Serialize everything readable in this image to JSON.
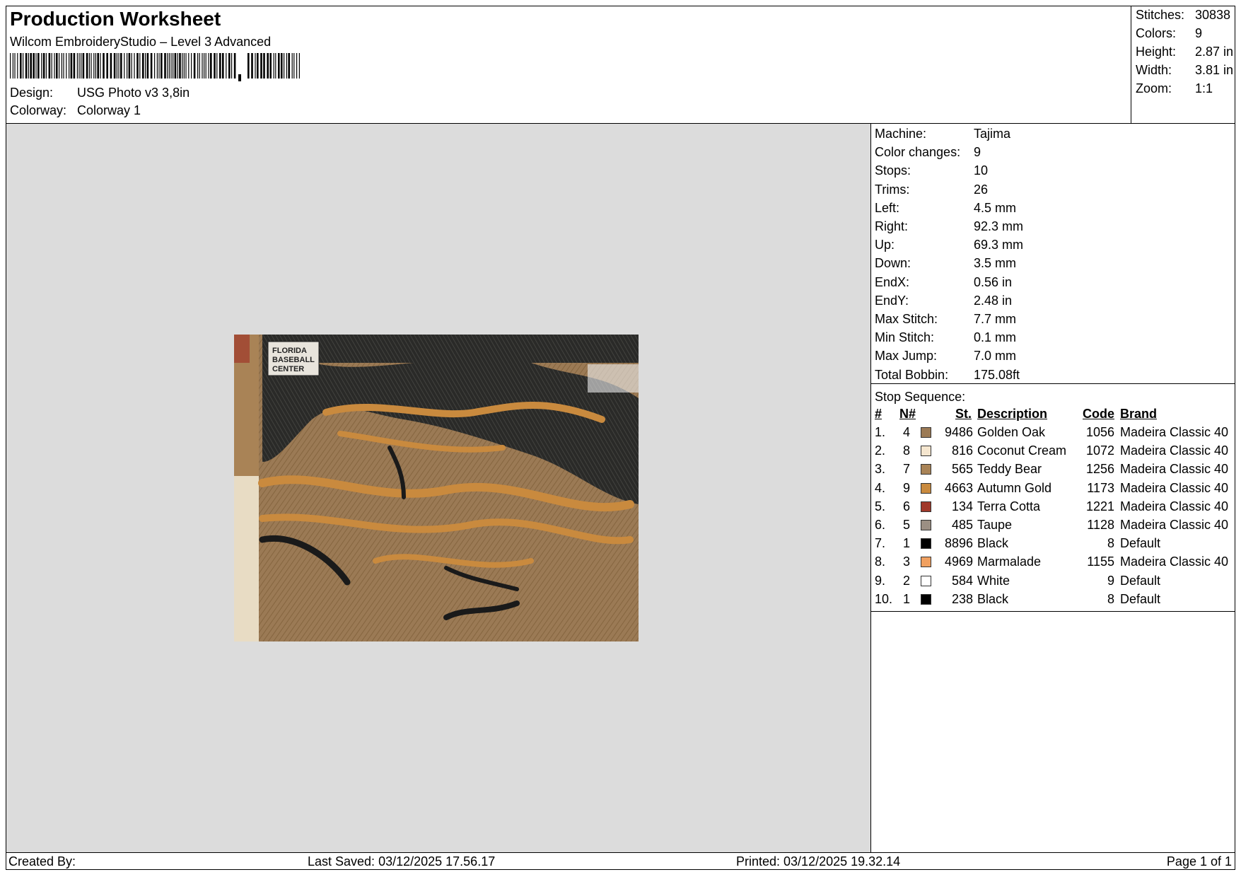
{
  "header": {
    "title": "Production Worksheet",
    "software": "Wilcom EmbroideryStudio – Level 3 Advanced",
    "design_label": "Design:",
    "design_value": "USG Photo v3 3,8in",
    "colorway_label": "Colorway:",
    "colorway_value": "Colorway 1"
  },
  "stats": [
    {
      "label": "Stitches:",
      "value": "30838"
    },
    {
      "label": "Colors:",
      "value": "9"
    },
    {
      "label": "Height:",
      "value": "2.87 in"
    },
    {
      "label": "Width:",
      "value": "3.81 in"
    },
    {
      "label": "Zoom:",
      "value": "1:1"
    }
  ],
  "preview": {
    "logo_lines": [
      "FLORIDA",
      "BASEBALL",
      "CENTER"
    ]
  },
  "machine": [
    {
      "label": "Machine:",
      "value": "Tajima"
    },
    {
      "label": "Color changes:",
      "value": "9"
    },
    {
      "label": "Stops:",
      "value": "10"
    },
    {
      "label": "Trims:",
      "value": "26"
    },
    {
      "label": "Left:",
      "value": "4.5 mm"
    },
    {
      "label": "Right:",
      "value": "92.3 mm"
    },
    {
      "label": "Up:",
      "value": "69.3 mm"
    },
    {
      "label": "Down:",
      "value": "3.5 mm"
    },
    {
      "label": "EndX:",
      "value": "0.56 in"
    },
    {
      "label": "EndY:",
      "value": "2.48 in"
    },
    {
      "label": "Max Stitch:",
      "value": "7.7 mm"
    },
    {
      "label": "Min Stitch:",
      "value": "0.1 mm"
    },
    {
      "label": "Max Jump:",
      "value": "7.0 mm"
    },
    {
      "label": "Total Bobbin:",
      "value": "175.08ft"
    }
  ],
  "stop_sequence": {
    "title": "Stop Sequence:",
    "headers": {
      "num": "#",
      "n": "N#",
      "st": "St.",
      "desc": "Description",
      "code": "Code",
      "brand": "Brand"
    },
    "rows": [
      {
        "num": "1.",
        "n": "4",
        "color": "#9b7a55",
        "st": "9486",
        "desc": "Golden Oak",
        "code": "1056",
        "brand": "Madeira Classic 40"
      },
      {
        "num": "2.",
        "n": "8",
        "color": "#f5e6cf",
        "st": "816",
        "desc": "Coconut Cream",
        "code": "1072",
        "brand": "Madeira Classic 40"
      },
      {
        "num": "3.",
        "n": "7",
        "color": "#a98356",
        "st": "565",
        "desc": "Teddy Bear",
        "code": "1256",
        "brand": "Madeira Classic 40"
      },
      {
        "num": "4.",
        "n": "9",
        "color": "#c98a3e",
        "st": "4663",
        "desc": "Autumn Gold",
        "code": "1173",
        "brand": "Madeira Classic 40"
      },
      {
        "num": "5.",
        "n": "6",
        "color": "#a0382a",
        "st": "134",
        "desc": "Terra Cotta",
        "code": "1221",
        "brand": "Madeira Classic 40"
      },
      {
        "num": "6.",
        "n": "5",
        "color": "#9b8f83",
        "st": "485",
        "desc": "Taupe",
        "code": "1128",
        "brand": "Madeira Classic 40"
      },
      {
        "num": "7.",
        "n": "1",
        "color": "#000000",
        "st": "8896",
        "desc": "Black",
        "code": "8",
        "brand": "Default"
      },
      {
        "num": "8.",
        "n": "3",
        "color": "#f0a060",
        "st": "4969",
        "desc": "Marmalade",
        "code": "1155",
        "brand": "Madeira Classic 40"
      },
      {
        "num": "9.",
        "n": "2",
        "color": "#ffffff",
        "st": "584",
        "desc": "White",
        "code": "9",
        "brand": "Default"
      },
      {
        "num": "10.",
        "n": "1",
        "color": "#000000",
        "st": "238",
        "desc": "Black",
        "code": "8",
        "brand": "Default"
      }
    ]
  },
  "footer": {
    "created_by": "Created By:",
    "last_saved": "Last Saved: 03/12/2025 17.56.17",
    "printed": "Printed: 03/12/2025 19.32.14",
    "page": "Page 1 of 1"
  }
}
